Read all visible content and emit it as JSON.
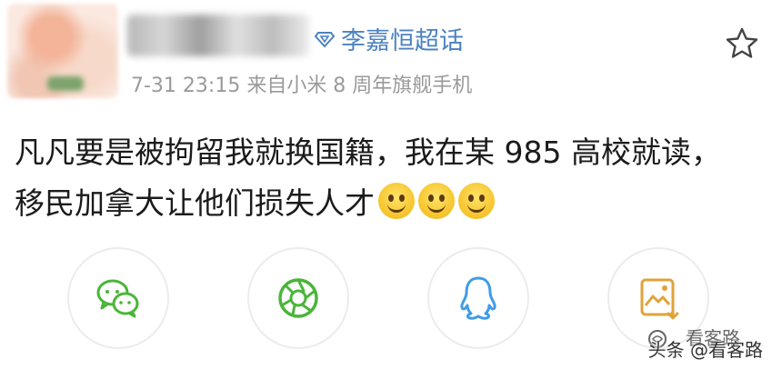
{
  "post": {
    "supertopic": "李嘉恒超话",
    "meta": "7-31 23:15  来自小米 8 周年旗舰手机",
    "content_text": "凡凡要是被拘留我就换国籍，我在某 985 高校就读，移民加拿大让他们损失人才",
    "emoji_count": 3
  },
  "share": {
    "items": [
      {
        "name": "wechat",
        "color": "#4bb53a"
      },
      {
        "name": "moments",
        "color": "#4bb53a"
      },
      {
        "name": "qq",
        "color": "#3f9ce8"
      },
      {
        "name": "save-image",
        "color": "#e0a33a"
      }
    ]
  },
  "watermark": {
    "logo_text": "看客路",
    "text": "头条 @看客路"
  },
  "colors": {
    "supertopic": "#4b82c0",
    "meta": "#9a9a9a"
  }
}
